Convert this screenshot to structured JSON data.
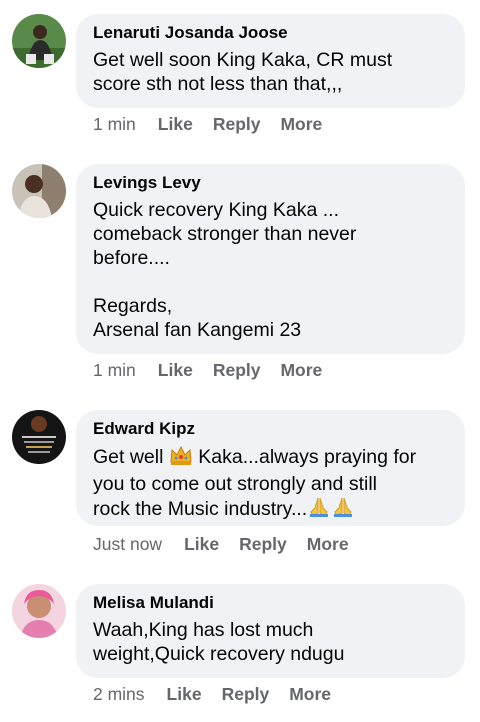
{
  "comments": [
    {
      "author": "Lenaruti Josanda Joose",
      "text": "Get well soon King Kaka, CR must\nscore sth not less than that,,,",
      "time": "1 min",
      "like": "Like",
      "reply": "Reply",
      "more": "More"
    },
    {
      "author": "Levings Levy",
      "text": "Quick recovery King Kaka ...\ncomeback stronger than never\nbefore....\n\nRegards,\nArsenal fan Kangemi 23",
      "time": "1 min",
      "like": "Like",
      "reply": "Reply",
      "more": "More"
    },
    {
      "author": "Edward Kipz",
      "text_part1": "Get well ",
      "emoji1": "crown-emoji",
      "text_part2": " Kaka...always praying for",
      "text_line2": "you to come out strongly and still",
      "text_line3": "rock the Music industry...",
      "emoji2": "praying-hands-emoji",
      "time": "Just now",
      "like": "Like",
      "reply": "Reply",
      "more": "More"
    },
    {
      "author": "Melisa Mulandi",
      "text": "Waah,King has lost much\nweight,Quick recovery ndugu",
      "time": "2 mins",
      "like": "Like",
      "reply": "Reply",
      "more": "More"
    }
  ],
  "colors": {
    "bubble": "#f0f2f5",
    "text": "#050505",
    "meta": "#65676b"
  }
}
